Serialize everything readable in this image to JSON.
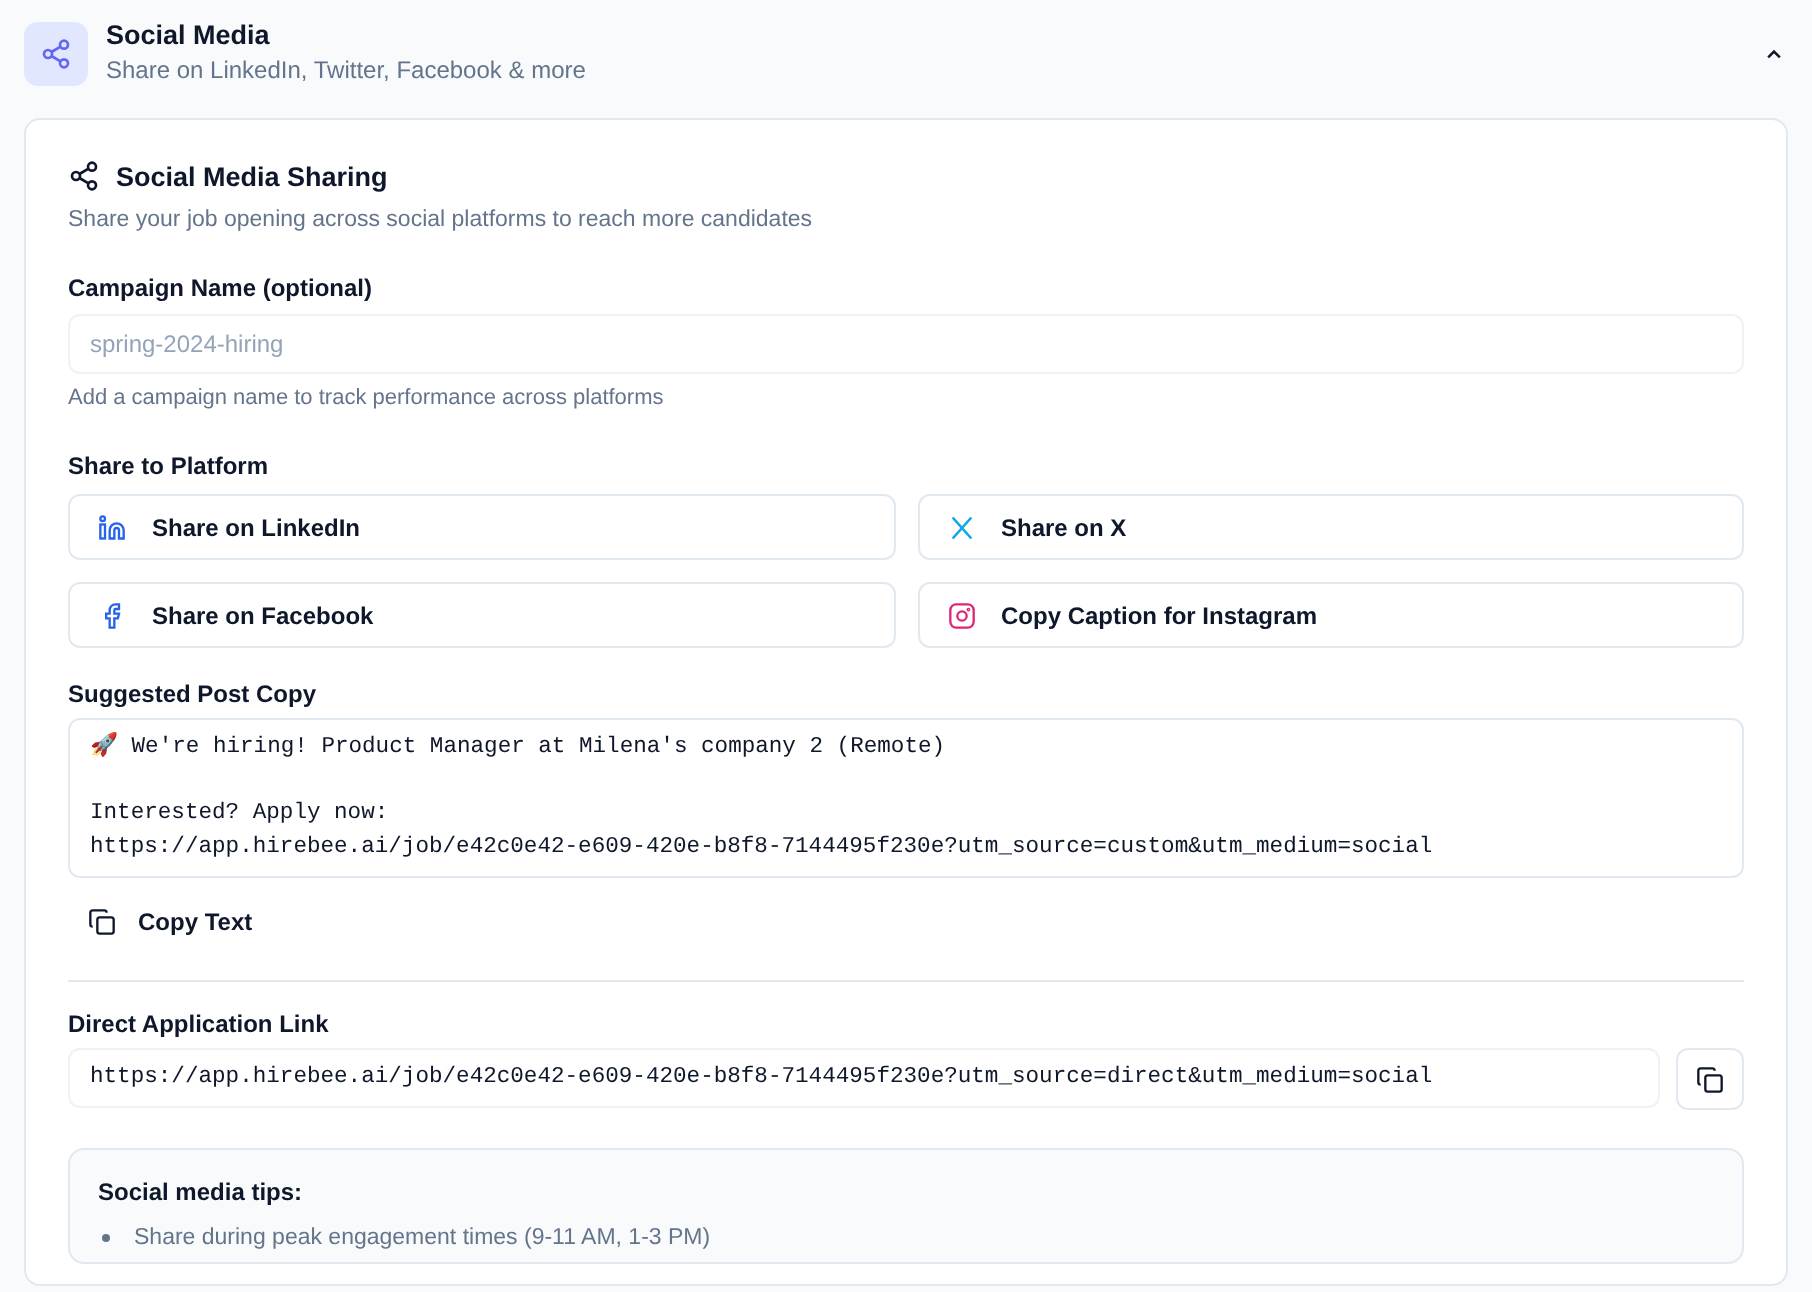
{
  "section": {
    "title": "Social Media",
    "subtitle": "Share on LinkedIn, Twitter, Facebook & more",
    "expanded": true
  },
  "card": {
    "title": "Social Media Sharing",
    "description": "Share your job opening across social platforms to reach more candidates"
  },
  "campaign": {
    "label": "Campaign Name (optional)",
    "placeholder": "spring-2024-hiring",
    "help": "Add a campaign name to track performance across platforms"
  },
  "platforms": {
    "label": "Share to Platform",
    "buttons": [
      {
        "kind": "linkedin",
        "label": "Share on LinkedIn"
      },
      {
        "kind": "x",
        "label": "Share on X"
      },
      {
        "kind": "facebook",
        "label": "Share on Facebook"
      },
      {
        "kind": "instagram",
        "label": "Copy Caption for Instagram"
      }
    ]
  },
  "post_copy": {
    "label": "Suggested Post Copy",
    "value": "🚀 We're hiring! Product Manager at Milena's company 2 (Remote)\n\nInterested? Apply now:\nhttps://app.hirebee.ai/job/e42c0e42-e609-420e-b8f8-7144495f230e?utm_source=custom&utm_medium=social",
    "copy_button": "Copy Text"
  },
  "direct_link": {
    "label": "Direct Application Link",
    "value": "https://app.hirebee.ai/job/e42c0e42-e609-420e-b8f8-7144495f230e?utm_source=direct&utm_medium=social"
  },
  "tips": {
    "title": "Social media tips:",
    "items": [
      "Share during peak engagement times (9-11 AM, 1-3 PM)"
    ]
  }
}
